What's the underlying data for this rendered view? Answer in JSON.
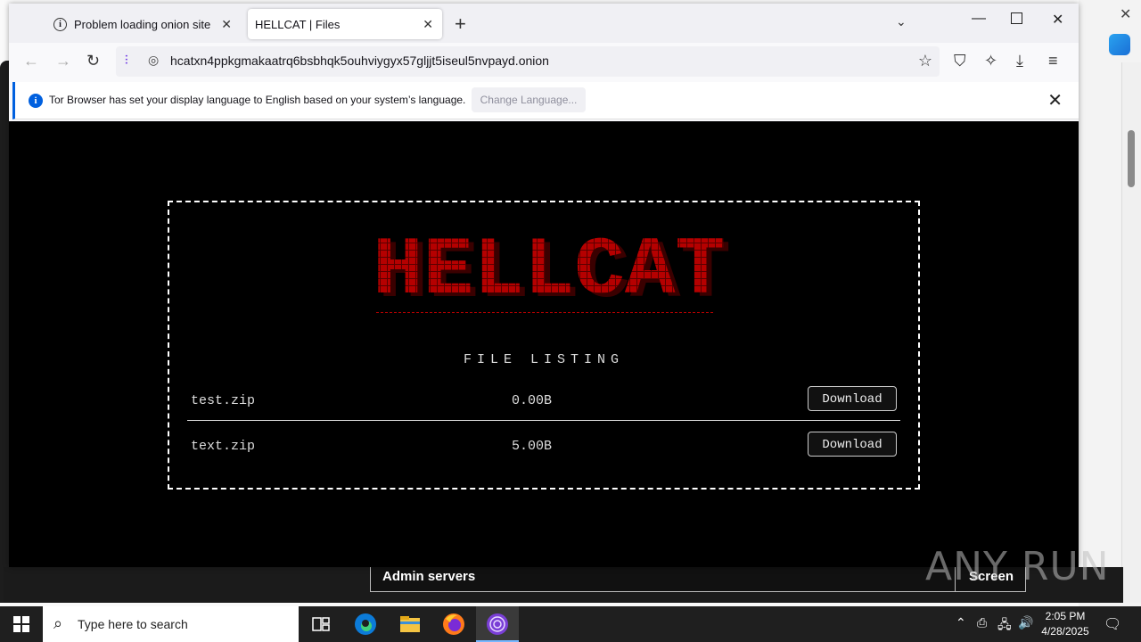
{
  "browser": {
    "tabs": [
      {
        "label": "Problem loading onion site",
        "icon": "info-icon"
      },
      {
        "label": "HELLCAT | Files",
        "active": true
      }
    ],
    "url": "hcatxn4ppkgmakaatrq6bsbhqk5ouhviygyx57gljjt5iseul5nvpayd.onion",
    "notification": {
      "text": "Tor Browser has set your display language to English based on your system’s language.",
      "button": "Change Language..."
    }
  },
  "page": {
    "logo_text": "HELLCAT",
    "listing_title": "FILE LISTING",
    "files": [
      {
        "name": "test.zip",
        "size": "0.00B",
        "action": "Download"
      },
      {
        "name": "text.zip",
        "size": "5.00B",
        "action": "Download"
      }
    ],
    "colors": {
      "logo": "#b50000",
      "background": "#000000"
    }
  },
  "background_window": {
    "bar_label": "Admin servers",
    "bar_button": "Screen"
  },
  "taskbar": {
    "search_placeholder": "Type here to search",
    "time": "2:05 PM",
    "date": "4/28/2025"
  },
  "watermark": "ANY RUN"
}
